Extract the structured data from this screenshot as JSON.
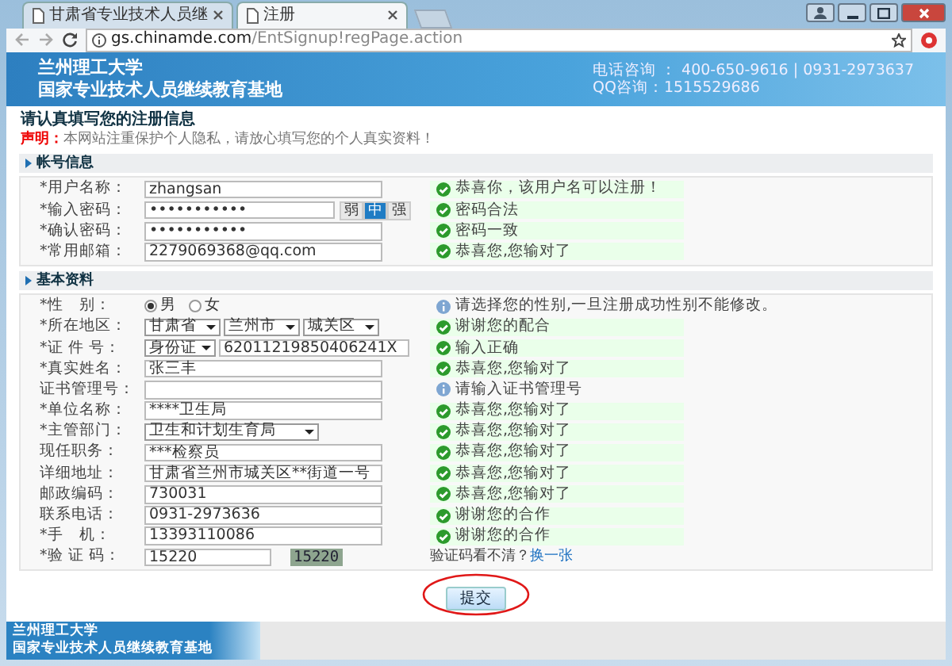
{
  "browser": {
    "tabs": [
      {
        "title": "甘肃省专业技术人员继",
        "selected": false
      },
      {
        "title": "注册",
        "selected": true
      }
    ],
    "url": {
      "host": "gs.chinamde.com",
      "path": "/EntSignup!regPage.action"
    }
  },
  "header": {
    "school": "兰州理工大学",
    "base": "国家专业技术人员继续教育基地",
    "phone": "电话咨询 ： 400-650-9616 | 0931-2973637",
    "qq": "QQ咨询：1515529686"
  },
  "form": {
    "title": "请认真填写您的注册信息",
    "notice_label": "声明：",
    "notice": "本网站注重保护个人隐私，请放心填写您的个人真实资料！",
    "sections": [
      {
        "title": "帐号信息",
        "rows": [
          {
            "label": "*用户名称：",
            "kind": "text",
            "value": "zhangsan",
            "valid": true,
            "message": "恭喜你，该用户名可以注册！"
          },
          {
            "label": "*输入密码：",
            "kind": "password",
            "value": "•••••••••••",
            "strength": [
              {
                "label": "弱",
                "selected": false
              },
              {
                "label": "中",
                "selected": true
              },
              {
                "label": "强",
                "selected": false
              }
            ],
            "valid": true,
            "message": "密码合法"
          },
          {
            "label": "*确认密码：",
            "kind": "password",
            "value": "•••••••••••",
            "valid": true,
            "message": "密码一致"
          },
          {
            "label": "*常用邮箱：",
            "kind": "text",
            "value": "2279069368@qq.com",
            "valid": true,
            "message": "恭喜您,您输对了"
          }
        ]
      },
      {
        "title": "基本资料",
        "rows": [
          {
            "label": "*性　别：",
            "kind": "radio",
            "options": [
              {
                "label": "男",
                "selected": true
              },
              {
                "label": "女",
                "selected": false
              }
            ],
            "valid": false,
            "message": "请选择您的性别,一旦注册成功性别不能修改。"
          },
          {
            "label": "*所在地区：",
            "kind": "selects",
            "selects": [
              "甘肃省",
              "兰州市",
              "城关区"
            ],
            "valid": true,
            "message": "谢谢您的配合"
          },
          {
            "label": "*证 件 号：",
            "kind": "select-text",
            "select": "身份证",
            "value": "62011219850406241X",
            "valid": true,
            "message": "输入正确"
          },
          {
            "label": "*真实姓名：",
            "kind": "text",
            "value": "张三丰",
            "valid": true,
            "message": "恭喜您,您输对了"
          },
          {
            "label": "证书管理号：",
            "kind": "text",
            "valid": false,
            "message": "请输入证书管理号"
          },
          {
            "label": "*单位名称：",
            "kind": "text",
            "value": "****卫生局",
            "valid": true,
            "message": "恭喜您,您输对了"
          },
          {
            "label": "*主管部门：",
            "kind": "select",
            "select": "卫生和计划生育局",
            "valid": true,
            "message": "恭喜您,您输对了"
          },
          {
            "label": "现任职务：",
            "kind": "text",
            "value": "***检察员",
            "valid": true,
            "message": "恭喜您,您输对了"
          },
          {
            "label": "详细地址：",
            "kind": "text",
            "value": "甘肃省兰州市城关区**街道一号",
            "valid": true,
            "message": "恭喜您,您输对了"
          },
          {
            "label": "邮政编码：",
            "kind": "text",
            "value": "730031",
            "valid": true,
            "message": "恭喜您,您输对了"
          },
          {
            "label": "联系电话：",
            "kind": "text",
            "value": "0931-2973636",
            "valid": true,
            "message": "谢谢您的合作"
          },
          {
            "label": "*手　机：",
            "kind": "text",
            "value": "13393110086",
            "valid": true,
            "message": "谢谢您的合作"
          },
          {
            "label": "*验 证 码：",
            "kind": "captcha",
            "value": "15220",
            "code": "15220",
            "hint": "验证码看不清？",
            "link": "换一张"
          }
        ]
      }
    ]
  },
  "submit": {
    "label": "提交",
    "circled": true
  },
  "footer": {
    "line1": "兰州理工大学",
    "line2": "国家专业技术人员继续教育基地"
  }
}
